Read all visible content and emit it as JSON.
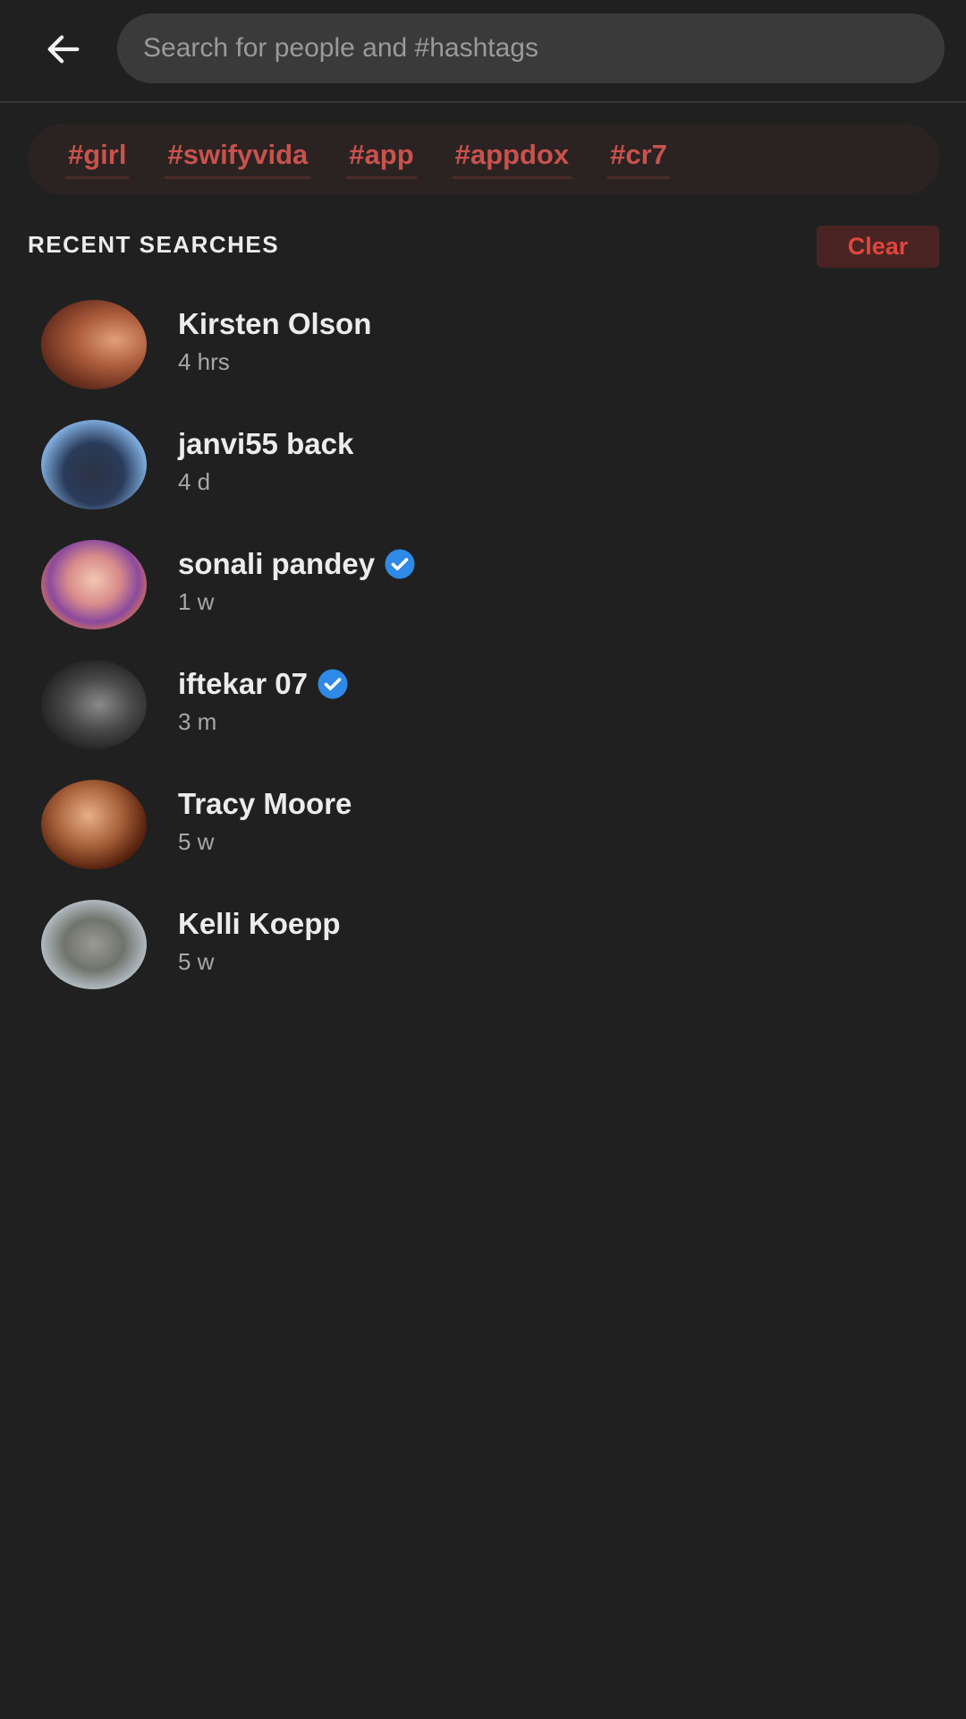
{
  "header": {
    "back_icon": "arrow-left-icon",
    "search_placeholder": "Search for people and #hashtags"
  },
  "hashtags": [
    "#girl",
    "#swifyvida",
    "#app",
    "#appdox",
    "#cr7"
  ],
  "recent": {
    "title": "RECENT SEARCHES",
    "clear_label": "Clear",
    "items": [
      {
        "name": "Kirsten Olson",
        "time": "4 hrs",
        "verified": false
      },
      {
        "name": "janvi55 back",
        "time": "4 d",
        "verified": false
      },
      {
        "name": "sonali pandey",
        "time": "1 w",
        "verified": true
      },
      {
        "name": "iftekar 07",
        "time": "3 m",
        "verified": true
      },
      {
        "name": "Tracy Moore",
        "time": "5 w",
        "verified": false
      },
      {
        "name": "Kelli Koepp",
        "time": "5 w",
        "verified": false
      }
    ]
  },
  "colors": {
    "background": "#202020",
    "hashtag": "#c9524d",
    "clear_text": "#e0463d",
    "verified": "#2e8ae6"
  }
}
